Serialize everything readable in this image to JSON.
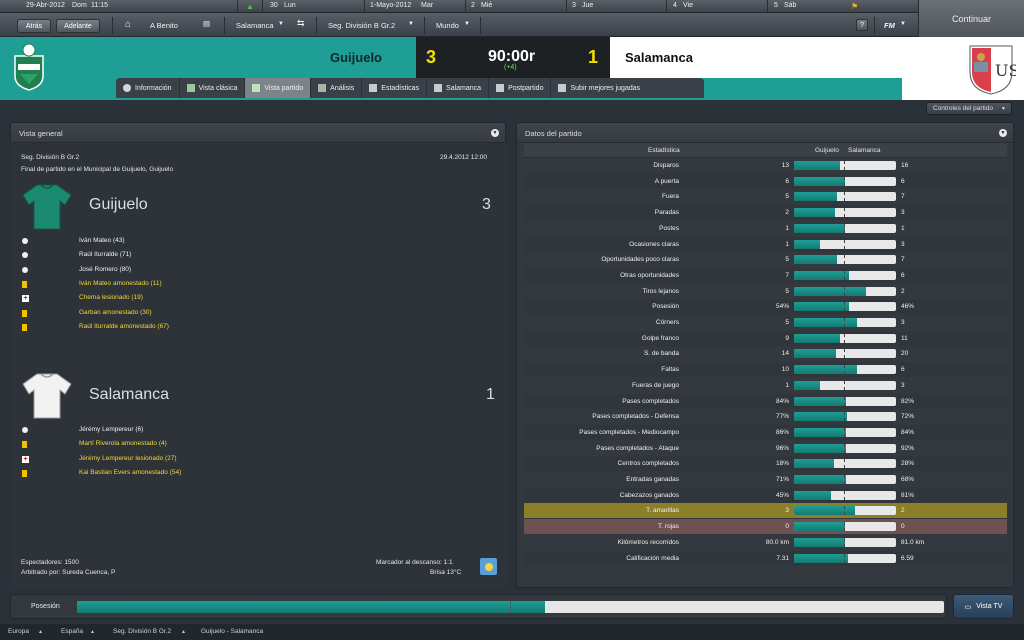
{
  "calendar": {
    "current_date": "29-Abr-2012",
    "current_day": "Dom",
    "current_time": "11:15",
    "days": [
      {
        "label": "30",
        "sub": "Lun"
      },
      {
        "label": "1-Mayo-2012",
        "sub": "Mar"
      },
      {
        "label": "2",
        "sub": "Mié"
      },
      {
        "label": "3",
        "sub": "Jue"
      },
      {
        "label": "4",
        "sub": "Vie"
      },
      {
        "label": "5",
        "sub": "Sáb"
      }
    ]
  },
  "continue_label": "Continuar",
  "nav": {
    "back": "Atrás",
    "forward": "Adelante",
    "manager": "A Benito",
    "club": "Salamanca",
    "competition": "Seg. División B Gr.2",
    "world": "Mundo",
    "help": "?",
    "fm": "FM"
  },
  "match": {
    "home_team": "Guijuelo",
    "away_team": "Salamanca",
    "home_score": "3",
    "away_score": "1",
    "clock": "90:00r",
    "added_time": "(+4)"
  },
  "tabs": [
    "Información",
    "Vista clásica",
    "Vista partido",
    "Análisis",
    "Estadísticas",
    "Salamanca",
    "Postpartido",
    "Subir mejores jugadas"
  ],
  "controls_label": "Controles del partido",
  "overview": {
    "title": "Vista general",
    "competition": "Seg. División B Gr.2",
    "date": "29.4.2012 12:00",
    "description": "Final de partido en el Municipal de Guijuelo, Guijuelo",
    "home_name": "Guijuelo",
    "home_score": "3",
    "away_name": "Salamanca",
    "away_score": "1",
    "home_events": [
      {
        "type": "goal",
        "text": "Iván Mateo (43)"
      },
      {
        "type": "goal",
        "text": "Raúl Iturralde (71)"
      },
      {
        "type": "goal",
        "text": "José Romero (80)"
      },
      {
        "type": "yellow",
        "text": "Iván Mateo amonestado (11)"
      },
      {
        "type": "injury",
        "text": "Chema lesionado (19)"
      },
      {
        "type": "yellow",
        "text": "Garban amonestado (30)"
      },
      {
        "type": "yellow",
        "text": "Raúl Iturralde amonestado (67)"
      }
    ],
    "away_events": [
      {
        "type": "goal",
        "text": "Jérémy Lempereur (6)"
      },
      {
        "type": "yellow",
        "text": "Martí Riverola amonestado (4)"
      },
      {
        "type": "injury",
        "text": "Jérémy Lempereur lesionado (27)"
      },
      {
        "type": "yellow",
        "text": "Kai Bastian Evers amonestado (54)"
      }
    ],
    "spectators": "Espectadores: 1500",
    "referee": "Arbitrado por: Sureda Cuenca, P",
    "half_time": "Marcador al descanso: 1:1",
    "weather": "Brisa 13°C"
  },
  "stats": {
    "title": "Datos del partido",
    "col_stat": "Estadística",
    "col_home": "Guijuelo",
    "col_away": "Salamanca",
    "rows": [
      {
        "label": "Disparos",
        "home": "13",
        "away": "16",
        "share": 0.45
      },
      {
        "label": "A puerta",
        "home": "6",
        "away": "6",
        "share": 0.5
      },
      {
        "label": "Fuera",
        "home": "5",
        "away": "7",
        "share": 0.42
      },
      {
        "label": "Paradas",
        "home": "2",
        "away": "3",
        "share": 0.4
      },
      {
        "label": "Postes",
        "home": "1",
        "away": "1",
        "share": 0.5
      },
      {
        "label": "Ocasiones claras",
        "home": "1",
        "away": "3",
        "share": 0.25
      },
      {
        "label": "Oportunidades poco claras",
        "home": "5",
        "away": "7",
        "share": 0.42
      },
      {
        "label": "Otras oportunidades",
        "home": "7",
        "away": "6",
        "share": 0.54
      },
      {
        "label": "Tiros lejanos",
        "home": "5",
        "away": "2",
        "share": 0.71
      },
      {
        "label": "Posesión",
        "home": "54%",
        "away": "46%",
        "share": 0.54
      },
      {
        "label": "Córners",
        "home": "5",
        "away": "3",
        "share": 0.62
      },
      {
        "label": "Golpe franco",
        "home": "9",
        "away": "11",
        "share": 0.45
      },
      {
        "label": "S. de banda",
        "home": "14",
        "away": "20",
        "share": 0.41
      },
      {
        "label": "Faltas",
        "home": "10",
        "away": "6",
        "share": 0.62
      },
      {
        "label": "Fueras de juego",
        "home": "1",
        "away": "3",
        "share": 0.25
      },
      {
        "label": "Pases completados",
        "home": "84%",
        "away": "82%",
        "share": 0.51
      },
      {
        "label": "Pases completados - Defensa",
        "home": "77%",
        "away": "72%",
        "share": 0.52
      },
      {
        "label": "Pases completados - Mediocampo",
        "home": "86%",
        "away": "84%",
        "share": 0.51
      },
      {
        "label": "Pases completados - Ataque",
        "home": "96%",
        "away": "92%",
        "share": 0.51
      },
      {
        "label": "Centros completados",
        "home": "18%",
        "away": "28%",
        "share": 0.39
      },
      {
        "label": "Entradas ganadas",
        "home": "71%",
        "away": "68%",
        "share": 0.51
      },
      {
        "label": "Cabezazos ganados",
        "home": "45%",
        "away": "81%",
        "share": 0.36
      },
      {
        "label": "T. amarillas",
        "home": "3",
        "away": "2",
        "share": 0.6,
        "highlight": "#8c7f2a"
      },
      {
        "label": "T. rojas",
        "home": "0",
        "away": "0",
        "share": 0.5,
        "highlight": "#6e5153"
      },
      {
        "label": "Kilómetros recorridos",
        "home": "80.0 km",
        "away": "81.0 km",
        "share": 0.5
      },
      {
        "label": "Calificación media",
        "home": "7.31",
        "away": "6.59",
        "share": 0.53
      }
    ]
  },
  "possession": {
    "label": "Posesión",
    "share": 0.54
  },
  "tv_label": "Vista TV",
  "breadcrumbs": [
    "Europa",
    "España",
    "Seg. División B Gr.2",
    "Guijuelo - Salamanca"
  ]
}
